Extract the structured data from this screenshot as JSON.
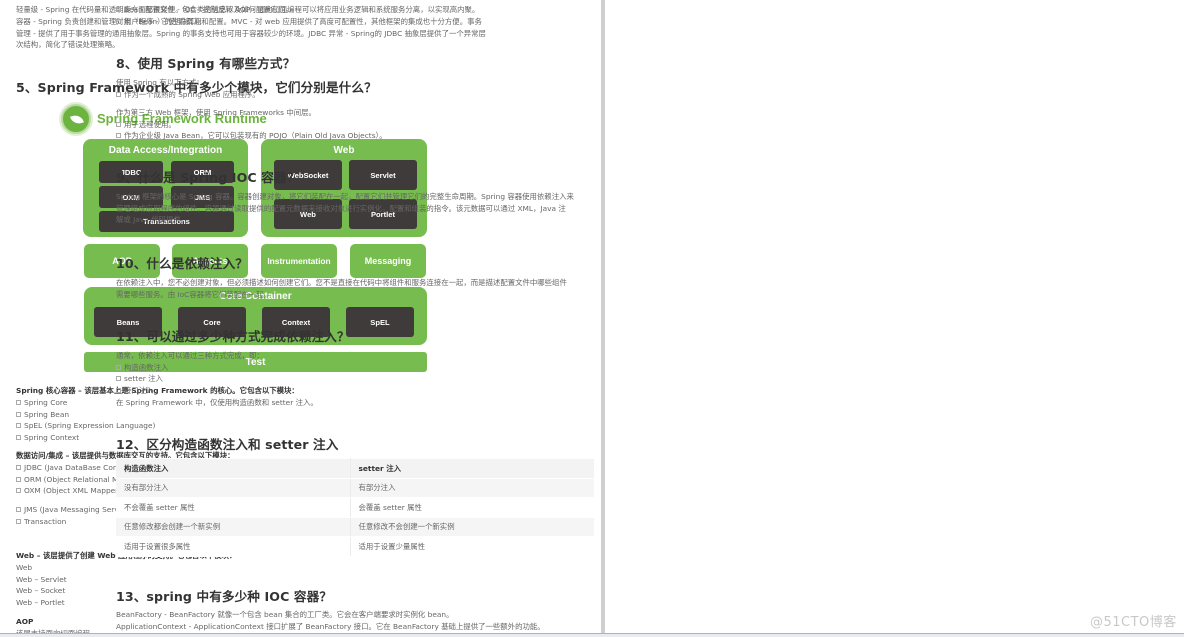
{
  "left_page": {
    "intro_paragraph": "轻量级 - Spring 在代码量和透明度方面都很轻便。IOC - 控制反转 AOP - 面向切面编程可以将应用业务逻辑和系统服务分离，以实现高内聚。容器 - Spring 负责创建和管理对象（Bean）的生命周期和配置。MVC - 对 web 应用提供了高度可配置性，其他框架的集成也十分方便。事务管理 - 提供了用于事务管理的通用抽象层。Spring 的事务支持也可用于容器较少的环境。JDBC 异常 - Spring的 JDBC 抽象层提供了一个异常层次结构，简化了错误处理策略。",
    "q5_heading": "5、Spring Framework 中有多少个模块，它们分别是什么？",
    "diagram": {
      "title": "Spring Framework Runtime",
      "data_access": {
        "label": "Data Access/Integration",
        "modules": [
          "JDBC",
          "ORM",
          "OXM",
          "JMS",
          "Transactions"
        ]
      },
      "web": {
        "label": "Web",
        "modules": [
          "WebSocket",
          "Servlet",
          "Web",
          "Portlet"
        ]
      },
      "middle": [
        "AOP",
        "Aspects",
        "Instrumentation",
        "Messaging"
      ],
      "core_container": {
        "label": "Core Container",
        "modules": [
          "Beans",
          "Core",
          "Context",
          "SpEL"
        ]
      },
      "test": "Test",
      "colors": {
        "green": "#77bc4e",
        "dark": "#3f3b3a",
        "logo": "#6db33f"
      }
    },
    "core_section": {
      "heading": "Spring 核心容器 – 该层基本上是 Spring Framework 的核心。它包含以下模块：",
      "items": [
        "Spring Core",
        "Spring Bean",
        "SpEL (Spring Expression Language)",
        "Spring Context"
      ]
    },
    "data_section": {
      "heading": "数据访问/集成 – 该层提供与数据库交互的支持。它包含以下模块：",
      "items": [
        "JDBC (Java DataBase Connectivity)",
        "ORM (Object Relational Mapping)",
        "OXM (Object XML Mappers)"
      ],
      "items2": [
        "JMS (Java Messaging Service)",
        "Transaction"
      ]
    },
    "web_section": {
      "heading": "Web – 该层提供了创建 Web 应用程序的支持。它包含以下模块：",
      "items": [
        "Web",
        "Web – Servlet",
        "Web – Socket",
        "Web – Portlet"
      ]
    },
    "aop_section": {
      "heading": "AOP",
      "text": "该层支持面向切面编程"
    }
  },
  "right_page": {
    "top_items": [
      "Bean 配置文件 - 包含类的信息以及如何配置它们。",
      "用户程序 - 它使用接口。"
    ],
    "q8": {
      "heading": "8、使用 Spring 有哪些方式？",
      "intro": "使用 Spring 有以下方式：",
      "item1": "作为一个成熟的 Spring Web 应用程序。",
      "line2": "作为第三方 Web 框架，使用 Spring Frameworks 中间层。",
      "items2": [
        "用于远程使用。",
        "作为企业级 Java Bean，它可以包装现有的 POJO（Plain Old Java Objects）。"
      ]
    },
    "q9": {
      "heading": "9、什么是 Spring IOC 容器？",
      "lines": [
        "Spring 框架的核心是 Spring 容器。容器创建对象，将它们装配在一起，配置它们并管理它们的完整生命周期。Spring 容器使用依赖注入来",
        "管理组成应用程序的组件。容器通过读取提供的配置元数据来接收对象进行实例化，配置和组装的指令。该元数据可以通过 XML，Java 注",
        "解或 Java 代码提供。"
      ]
    },
    "q10": {
      "heading": "10、什么是依赖注入？",
      "lines": [
        "在依赖注入中，您不必创建对象，但必须描述如何创建它们。您不是直接在代码中将组件和服务连接在一起，而是描述配置文件中哪些组件",
        "需要哪些服务。由 IoC容器将它们装配在一起。"
      ]
    },
    "q11": {
      "heading": "11、可以通过多少种方式完成依赖注入？",
      "intro": "通常，依赖注入可以通过三种方式完成，即：",
      "items": [
        "构造函数注入",
        "setter 注入",
        "接口注入"
      ],
      "outro": "在 Spring Framework 中，仅使用构造函数和 setter 注入。"
    },
    "q12": {
      "heading": "12、区分构造函数注入和 setter 注入",
      "table": {
        "headers": [
          "构造函数注入",
          "setter 注入"
        ],
        "rows": [
          [
            "没有部分注入",
            "有部分注入"
          ],
          [
            "不会覆盖 setter 属性",
            "会覆盖 setter 属性"
          ],
          [
            "任意修改都会创建一个新实例",
            "任意修改不会创建一个新实例"
          ],
          [
            "适用于设置很多属性",
            "适用于设置少量属性"
          ]
        ]
      }
    },
    "q13": {
      "heading": "13、spring 中有多少种 IOC 容器？",
      "lines": [
        "BeanFactory - BeanFactory 就像一个包含 bean 集合的工厂类。它会在客户端要求时实例化 bean。",
        "ApplicationContext - ApplicationContext 接口扩展了 BeanFactory 接口。它在 BeanFactory 基础上提供了一些额外的功能。"
      ]
    },
    "watermark": "@51CTO博客"
  }
}
